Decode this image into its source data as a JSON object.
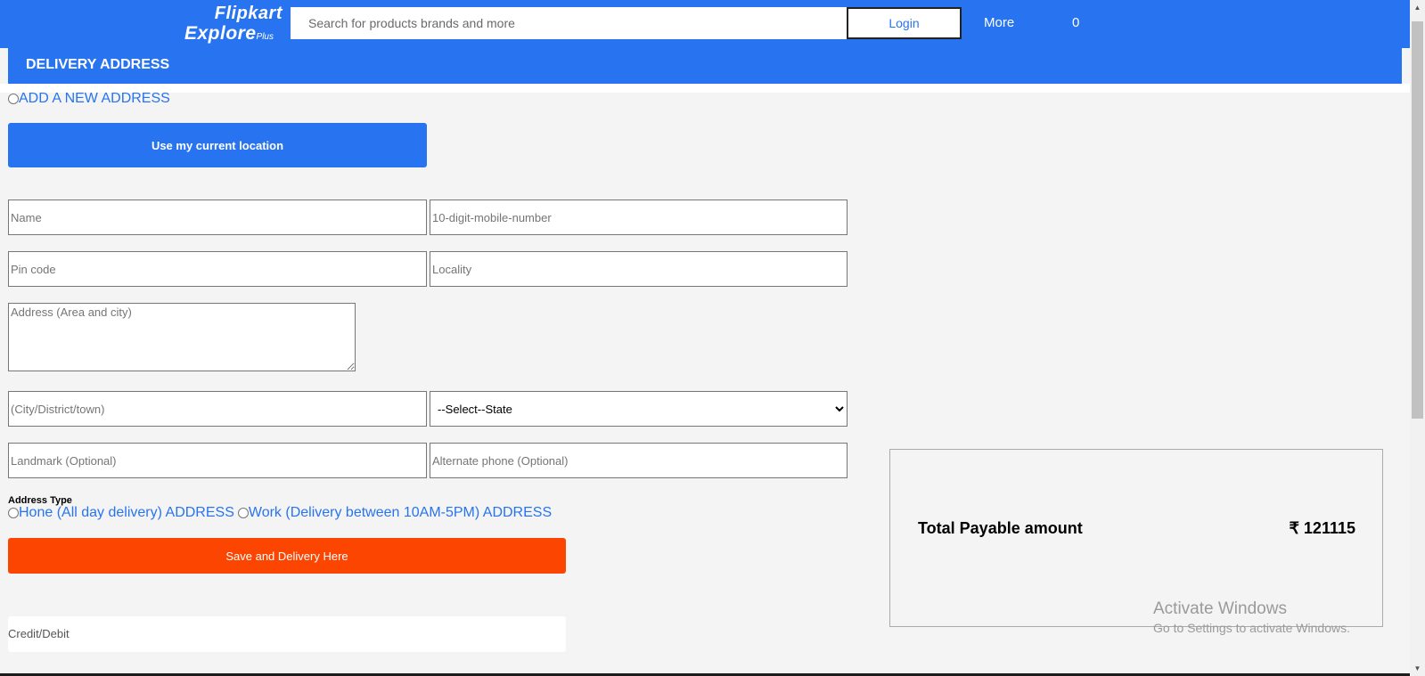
{
  "header": {
    "logo_brand": "Flipkart",
    "logo_explore": "Explore",
    "logo_plus": "Plus",
    "search_placeholder": "Search for products brands and more",
    "login_label": "Login",
    "more_label": "More",
    "cart_count": "0"
  },
  "delivery": {
    "section_title": "DELIVERY ADDRESS",
    "add_new_address_label": "ADD A NEW ADDRESS",
    "use_location_label": "Use my current location",
    "fields": {
      "name_placeholder": "Name",
      "mobile_placeholder": "10-digit-mobile-number",
      "pincode_placeholder": "Pin code",
      "locality_placeholder": "Locality",
      "address_placeholder": "Address (Area and city)",
      "city_placeholder": "(City/District/town)",
      "state_selected": "--Select--State",
      "landmark_placeholder": "Landmark (Optional)",
      "alt_phone_placeholder": "Alternate phone (Optional)"
    },
    "address_type_label": "Address Type",
    "home_option_label": "Hone (All day delivery) ADDRESS",
    "work_option_label": "Work (Delivery between 10AM-5PM) ADDRESS",
    "save_button_label": "Save and Delivery Here"
  },
  "payment": {
    "credit_debit_label": "Credit/Debit"
  },
  "summary": {
    "total_label": "Total Payable amount",
    "total_value": "₹ 121115"
  },
  "watermark": {
    "title": "Activate Windows",
    "subtitle": "Go to Settings to activate Windows."
  },
  "colors": {
    "accent": "#2874f0",
    "save_button": "#fb4500",
    "background": "#f4f4f4"
  }
}
